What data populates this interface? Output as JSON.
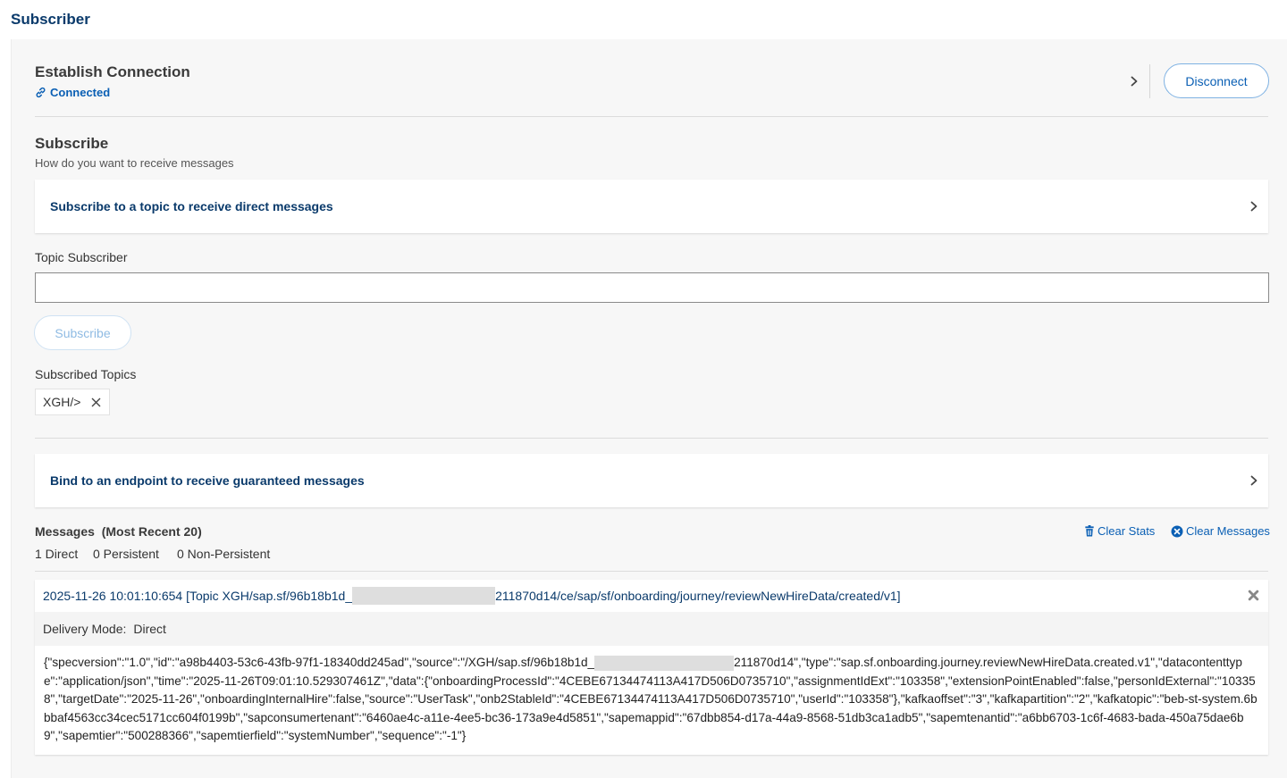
{
  "page": {
    "title": "Subscriber"
  },
  "connection": {
    "title": "Establish Connection",
    "status": "Connected",
    "disconnect_label": "Disconnect"
  },
  "subscribe": {
    "title": "Subscribe",
    "subtitle": "How do you want to receive messages",
    "topic_card_label": "Subscribe to a topic to receive direct messages",
    "topic_subscriber_label": "Topic Subscriber",
    "topic_input_value": "",
    "subscribe_button": "Subscribe",
    "subscribed_topics_label": "Subscribed Topics",
    "subscribed_topics": [
      "XGH/>"
    ],
    "endpoint_card_label": "Bind to an endpoint to receive guaranteed messages"
  },
  "messages": {
    "title": "Messages",
    "subtitle": "(Most Recent 20)",
    "clear_stats": "Clear Stats",
    "clear_messages": "Clear Messages",
    "stats": {
      "direct": "1 Direct",
      "persistent": "0 Persistent",
      "non_persistent": "0 Non-Persistent"
    },
    "items": [
      {
        "header_prefix": "2025-11-26 10:01:10:654 [Topic XGH/sap.sf/96b18b1d_",
        "header_suffix": "211870d14/ce/sap/sf/onboarding/journey/reviewNewHireData/created/v1]",
        "delivery_mode_label": "Delivery Mode:",
        "delivery_mode_value": "Direct",
        "payload_prefix": "{\"specversion\":\"1.0\",\"id\":\"a98b4403-53c6-43fb-97f1-18340dd245ad\",\"source\":\"/XGH/sap.sf/96b18b1d_",
        "payload_suffix": "211870d14\",\"type\":\"sap.sf.onboarding.journey.reviewNewHireData.created.v1\",\"datacontenttype\":\"application/json\",\"time\":\"2025-11-26T09:01:10.529307461Z\",\"data\":{\"onboardingProcessId\":\"4CEBE67134474113A417D506D0735710\",\"assignmentIdExt\":\"103358\",\"extensionPointEnabled\":false,\"personIdExternal\":\"103358\",\"targetDate\":\"2025-11-26\",\"onboardingInternalHire\":false,\"source\":\"UserTask\",\"onb2StableId\":\"4CEBE67134474113A417D506D0735710\",\"userId\":\"103358\"},\"kafkaoffset\":\"3\",\"kafkapartition\":\"2\",\"kafkatopic\":\"beb-st-system.6bbbaf4563cc34cec5171cc604f0199b\",\"sapconsumertenant\":\"6460ae4c-a11e-4ee5-bc36-173a9e4d5851\",\"sapemappid\":\"67dbb854-d17a-44a9-8568-51db3ca1adb5\",\"sapemtenantid\":\"a6bb6703-1c6f-4683-bada-450a75dae6b9\",\"sapemtier\":\"500288366\",\"sapemtierfield\":\"systemNumber\",\"sequence\":\"-1\"}"
      }
    ]
  },
  "icons": {
    "link": "link-icon",
    "chevron": "chevron-right-icon",
    "close": "close-icon",
    "trash": "trash-icon",
    "clear": "times-circle-icon"
  },
  "colors": {
    "accent": "#0a5fb4",
    "title": "#0a3a6b",
    "panel_bg": "#f7f7f7"
  }
}
